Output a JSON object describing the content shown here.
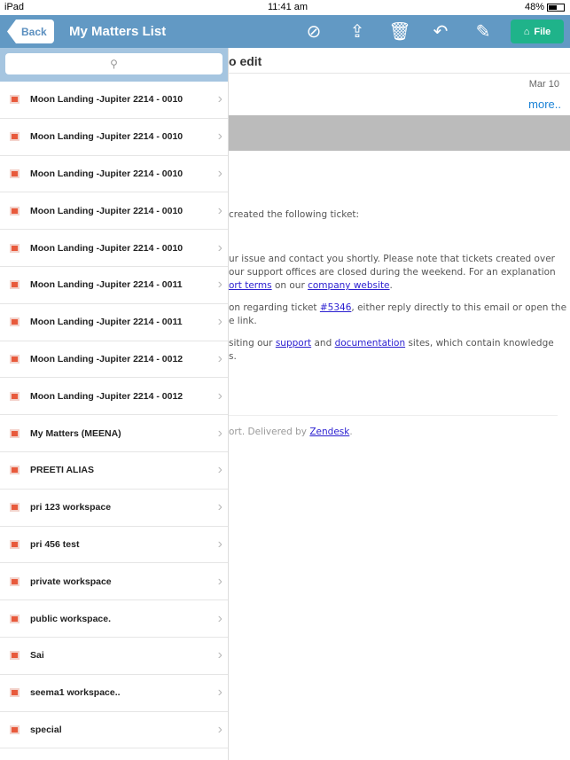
{
  "status": {
    "device": "iPad",
    "time": "11:41 am",
    "battery": "48%",
    "battery_level": 0.48
  },
  "header": {
    "back": "Back",
    "title": "My Matters List",
    "file": "File",
    "icons": [
      "no-file-icon",
      "move-icon",
      "trash-icon",
      "reply-icon",
      "edit-icon"
    ]
  },
  "search": {
    "placeholder": ""
  },
  "matters": [
    "Moon Landing -Jupiter 2214 - 0010",
    "Moon Landing -Jupiter 2214 - 0010",
    "Moon Landing -Jupiter 2214 - 0010",
    "Moon Landing -Jupiter 2214 - 0010",
    "Moon Landing -Jupiter 2214 - 0010",
    "Moon Landing -Jupiter 2214 - 0011",
    "Moon Landing -Jupiter 2214 - 0011",
    "Moon Landing -Jupiter 2214 - 0012",
    "Moon Landing -Jupiter 2214 - 0012",
    "My Matters (MEENA)",
    "PREETI ALIAS",
    "pri 123 workspace",
    "pri 456 test",
    "private workspace",
    "public workspace.",
    "Sai",
    "seema1 workspace..",
    "special"
  ],
  "email": {
    "subject": "o edit",
    "date": "Mar 10",
    "more": "more..",
    "l1": "created the following ticket:",
    "l2": "ur issue and contact you shortly. Please note that tickets created over",
    "l3": "our support offices are closed during the weekend. For an explanation",
    "l4a": "ort terms",
    "l4b": " on our ",
    "l4c": "company website",
    "l4d": ".",
    "l5a": "on regarding ticket ",
    "l5b": "#5346",
    "l5c": ", either reply directly to this email or open the",
    "l6": "e link.",
    "l7a": "siting our ",
    "l7b": "support",
    "l7c": " and ",
    "l7d": "documentation",
    "l7e": " sites, which contain knowledge",
    "l8": "s.",
    "f1": "ort. Delivered by ",
    "f2": "Zendesk",
    "f3": "."
  }
}
